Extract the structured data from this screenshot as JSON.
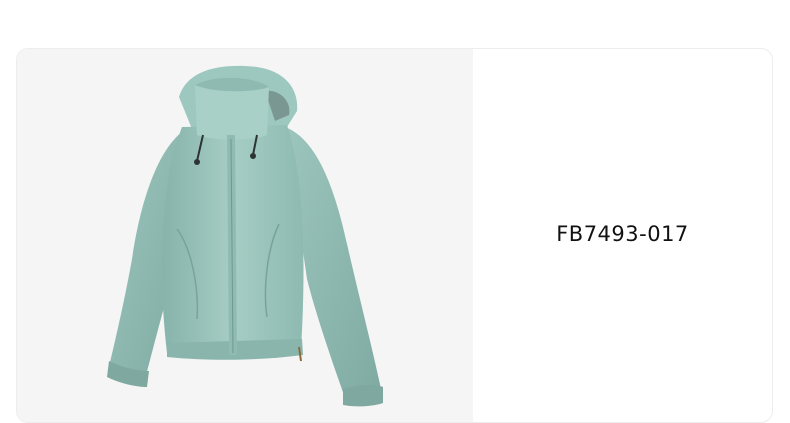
{
  "product": {
    "image_name": "jacket-image",
    "sku": "FB7493-017"
  }
}
